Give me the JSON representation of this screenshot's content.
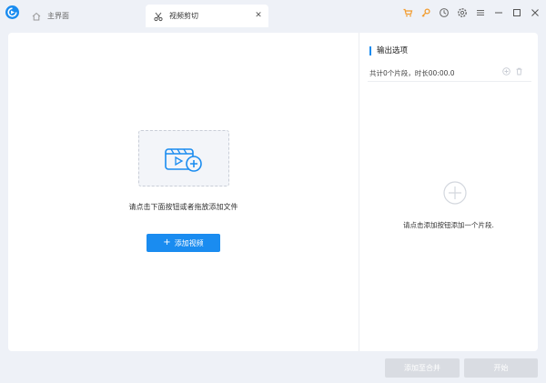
{
  "tabs": [
    {
      "label": "主界面",
      "icon": "home-icon"
    },
    {
      "label": "视频剪切",
      "icon": "scissors-icon"
    }
  ],
  "titlebar": {
    "icons": [
      "cart-icon",
      "key-icon",
      "history-icon",
      "settings-icon",
      "menu-icon",
      "minimize-icon",
      "maximize-icon",
      "close-icon"
    ]
  },
  "left": {
    "hint": "请点击下面按钮或者拖放添加文件",
    "add_button": "添加视频"
  },
  "right": {
    "title": "输出选项",
    "summary": "共计0个片段，时长00:00.0",
    "hint": "请点击添加按钮添加一个片段."
  },
  "footer": {
    "merge_button": "添加至合并",
    "start_button": "开始"
  },
  "colors": {
    "accent": "#1a8cf0",
    "orange": "#f29b2c",
    "disabled": "#d9dce2"
  }
}
